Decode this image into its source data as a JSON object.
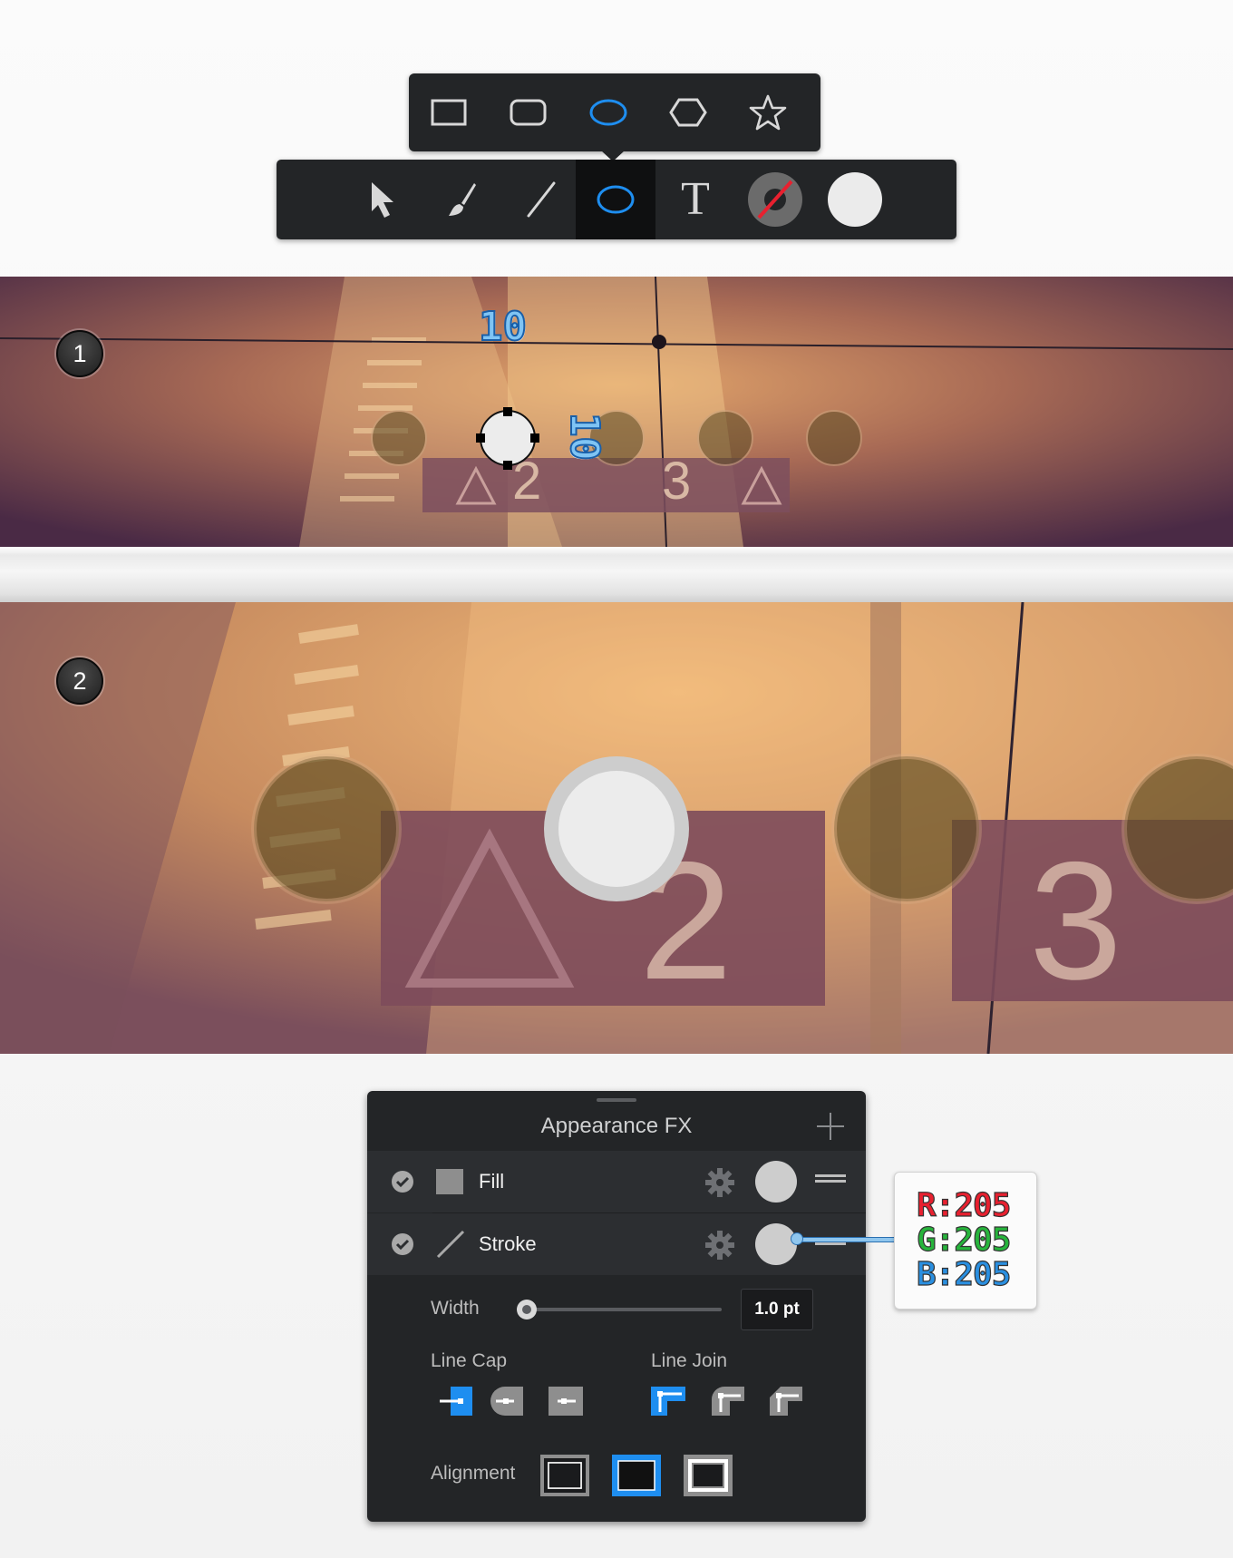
{
  "shape_popup": {
    "items": [
      {
        "name": "rectangle",
        "icon": "rectangle-icon"
      },
      {
        "name": "rounded-rectangle",
        "icon": "rounded-rectangle-icon"
      },
      {
        "name": "ellipse",
        "icon": "ellipse-icon",
        "selected": true
      },
      {
        "name": "polygon",
        "icon": "hexagon-icon"
      },
      {
        "name": "star",
        "icon": "star-icon"
      }
    ]
  },
  "main_toolbar": {
    "tools": [
      {
        "name": "select",
        "icon": "arrow-cursor-icon"
      },
      {
        "name": "brush",
        "icon": "brush-icon"
      },
      {
        "name": "line",
        "icon": "line-icon"
      },
      {
        "name": "ellipse",
        "icon": "ellipse-icon",
        "selected": true
      },
      {
        "name": "text",
        "icon": "text-icon",
        "glyph": "T"
      },
      {
        "name": "stroke-color",
        "icon": "stroke-color-icon"
      },
      {
        "name": "fill-color",
        "icon": "fill-color-icon"
      }
    ],
    "fill_color": "#ebebeb",
    "accent": "#1e8ef0"
  },
  "step1": {
    "badge": "1",
    "width_label": "10",
    "height_label": "10"
  },
  "step2": {
    "badge": "2"
  },
  "appearance": {
    "title": "Appearance FX",
    "rows": [
      {
        "label": "Fill",
        "enabled": true,
        "color": "#cdcdcd"
      },
      {
        "label": "Stroke",
        "enabled": true,
        "color": "#cdcdcd"
      }
    ],
    "width_label": "Width",
    "width_value": "1.0 pt",
    "width_slider_fraction": 0.05,
    "line_cap_label": "Line Cap",
    "line_join_label": "Line Join",
    "alignment_label": "Alignment",
    "line_cap_selected": 0,
    "line_join_selected": 0,
    "alignment_selected": 1
  },
  "rgb_callout": {
    "r": "R:205",
    "g": "G:205",
    "b": "B:205",
    "r_color": "#e8202f",
    "g_color": "#27b43c",
    "b_color": "#2a8fe0"
  }
}
